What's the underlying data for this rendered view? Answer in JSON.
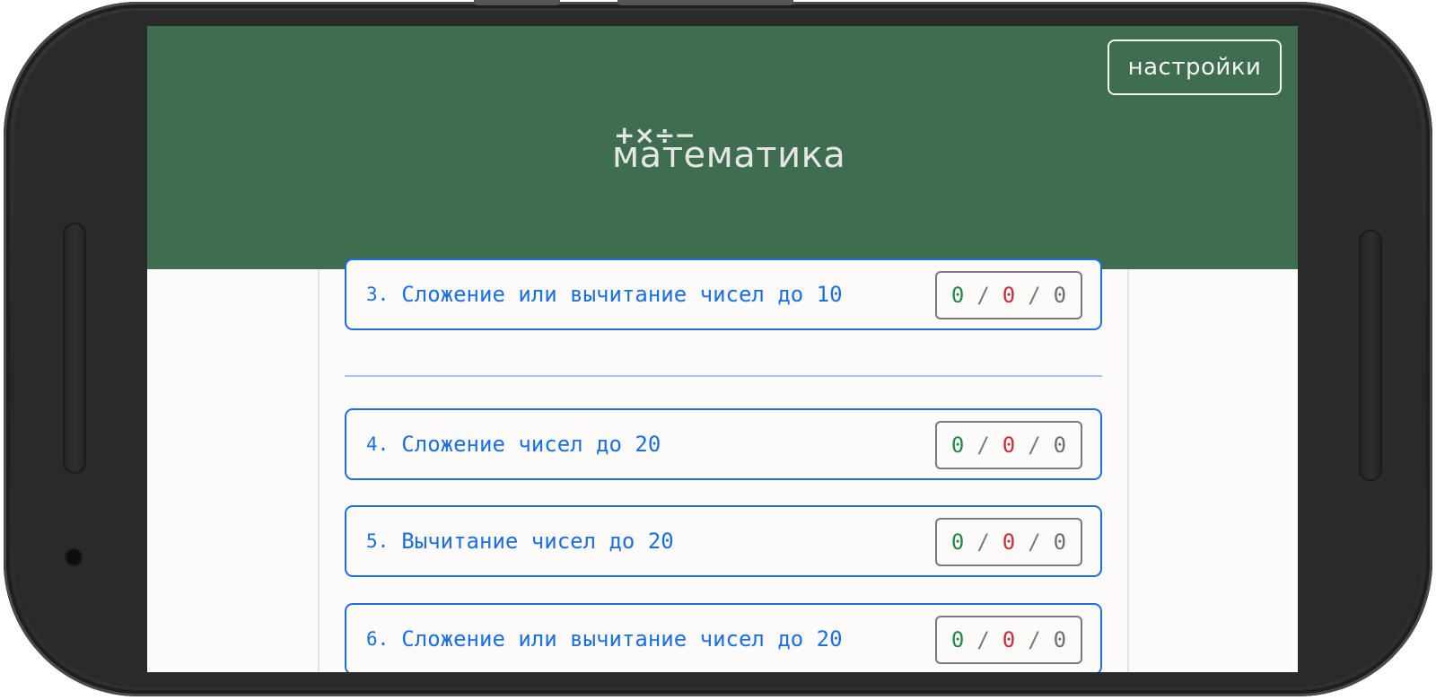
{
  "header": {
    "settings_label": "настройки",
    "logo_symbols": "+×÷−",
    "logo_word": "математика"
  },
  "tasks": [
    {
      "number": "3.",
      "title": "Сложение или вычитание чисел до 10",
      "correct": "0",
      "wrong": "0",
      "total": "0"
    },
    {
      "number": "4.",
      "title": "Сложение чисел до 20",
      "correct": "0",
      "wrong": "0",
      "total": "0"
    },
    {
      "number": "5.",
      "title": "Вычитание чисел до 20",
      "correct": "0",
      "wrong": "0",
      "total": "0"
    },
    {
      "number": "6.",
      "title": "Сложение или вычитание чисел до 20",
      "correct": "0",
      "wrong": "0",
      "total": "0"
    }
  ],
  "score_separator": "/",
  "colors": {
    "header_bg": "#3e6e4f",
    "accent_blue": "#1a6ee8",
    "correct_green": "#1e8a4a",
    "wrong_red": "#d02a36",
    "neutral_gray": "#6f6f6f"
  }
}
